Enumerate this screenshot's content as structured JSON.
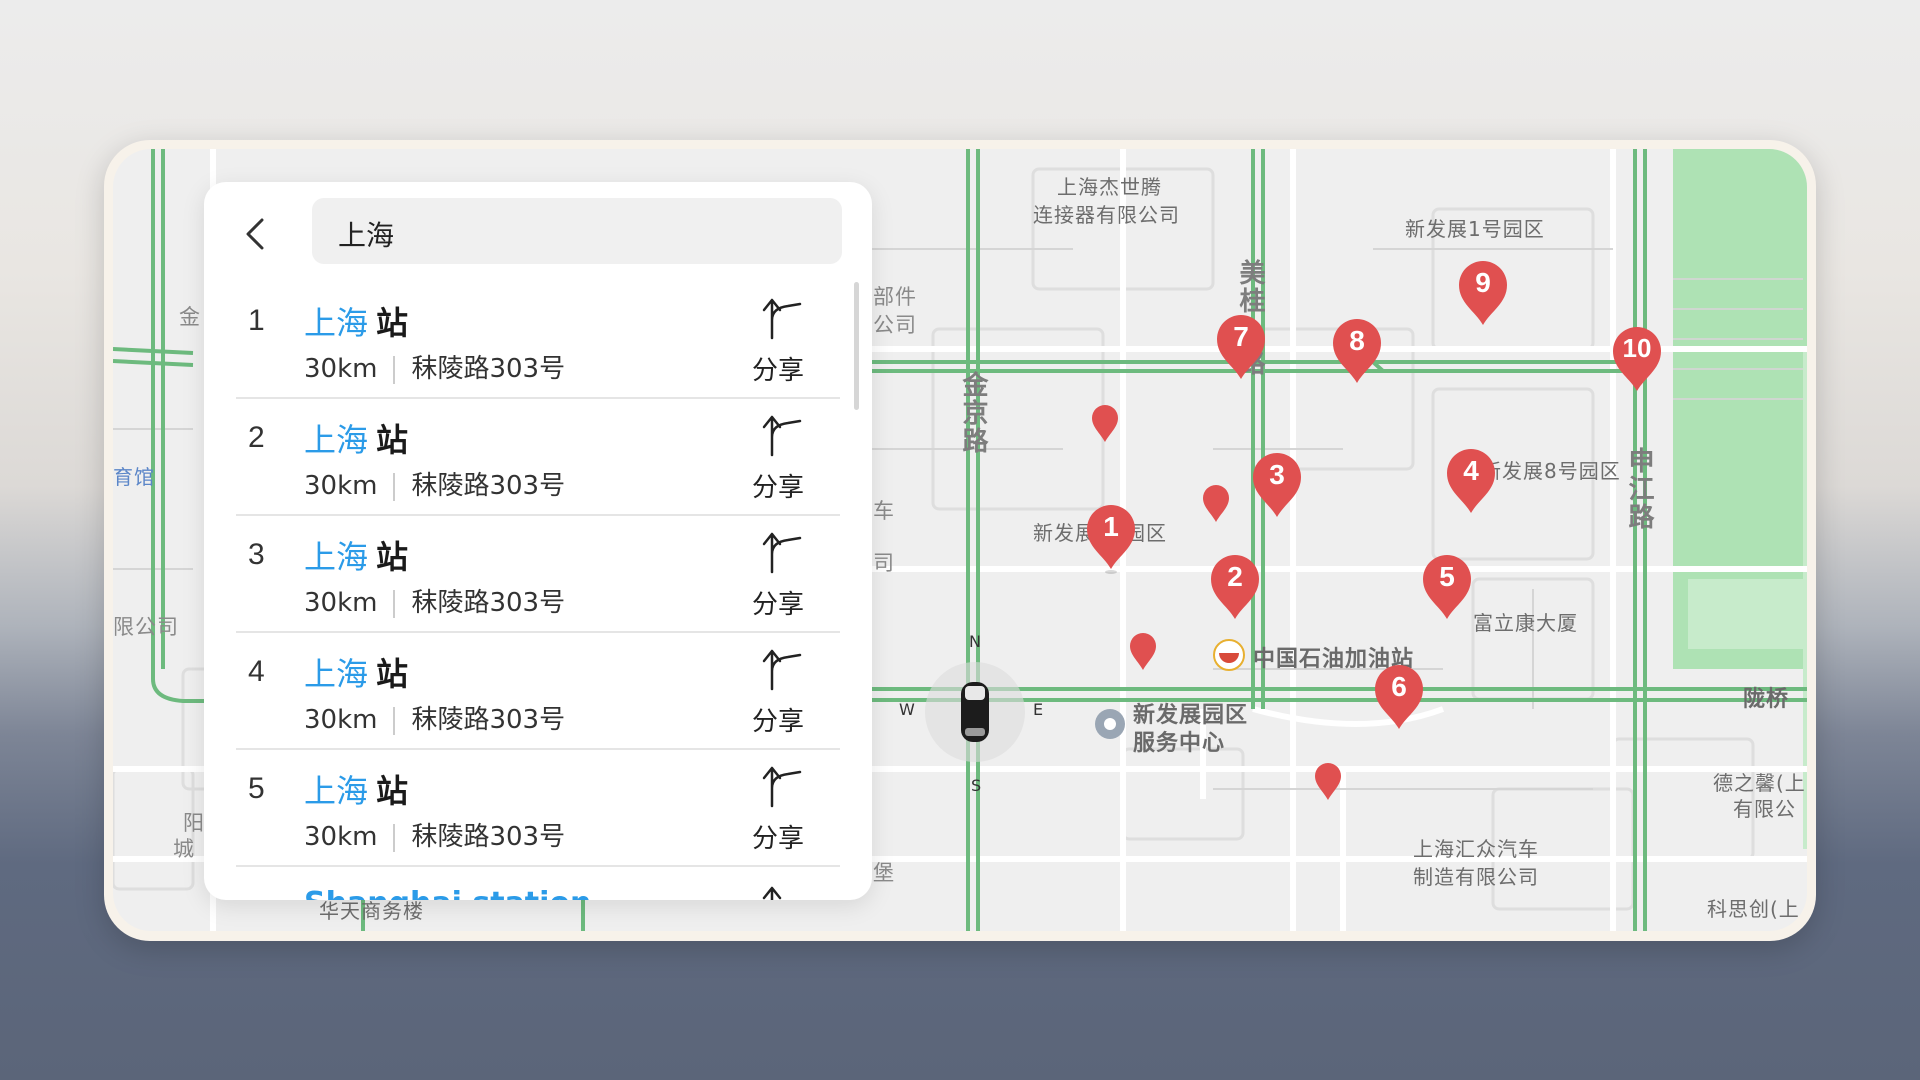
{
  "search": {
    "query": "上海"
  },
  "results": [
    {
      "index": "1",
      "highlight": "上海",
      "name": "站",
      "distance": "30km",
      "address": "秣陵路303号",
      "share_label": "分享"
    },
    {
      "index": "2",
      "highlight": "上海",
      "name": "站",
      "distance": "30km",
      "address": "秣陵路303号",
      "share_label": "分享"
    },
    {
      "index": "3",
      "highlight": "上海",
      "name": "站",
      "distance": "30km",
      "address": "秣陵路303号",
      "share_label": "分享"
    },
    {
      "index": "4",
      "highlight": "上海",
      "name": "站",
      "distance": "30km",
      "address": "秣陵路303号",
      "share_label": "分享"
    },
    {
      "index": "5",
      "highlight": "上海",
      "name": "站",
      "distance": "30km",
      "address": "秣陵路303号",
      "share_label": "分享"
    }
  ],
  "partial_result": {
    "text": "Shanghai station"
  },
  "map": {
    "labels": {
      "l1": "上海杰世腾",
      "l2": "连接器有限公司",
      "l3": "新发展1号园区",
      "l4": "美桂",
      "l5": "路",
      "l6": "金京路",
      "l7": "部件",
      "l8": "公司",
      "l9": "新发展",
      "l10": "园区",
      "l11": "新发展8号园区",
      "l12": "申江路",
      "l13": "富立康大厦",
      "l14": "中国石油加油站",
      "l15": "新发展园区",
      "l16": "服务中心",
      "l17": "陇桥",
      "l18": "德之馨(上",
      "l19": "有限公",
      "l20": "上海汇众汽车",
      "l21": "制造有限公司",
      "l22": "科思创(上",
      "l23": "华天商务楼",
      "l24": "金",
      "l25": "育馆",
      "l26": "限公司",
      "l27": "阳",
      "l28": "城",
      "l29": "堡",
      "l30": "车",
      "l31": "司"
    },
    "compass": {
      "n": "N",
      "s": "S",
      "w": "W",
      "e": "E"
    },
    "pins": [
      "1",
      "2",
      "3",
      "4",
      "5",
      "6",
      "7",
      "8",
      "9",
      "10"
    ],
    "colors": {
      "road_green": "#6dba7e",
      "pin_red": "#e05050",
      "highlight_blue": "#2b9be8"
    }
  }
}
